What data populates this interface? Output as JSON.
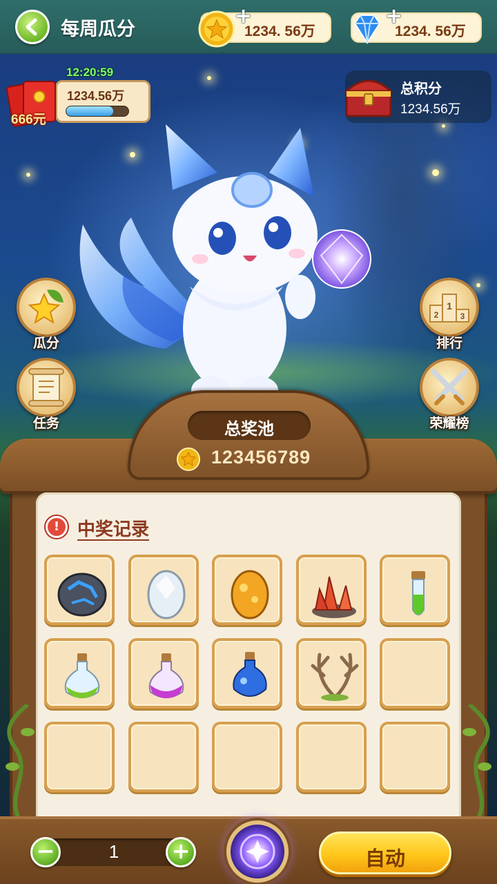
{
  "header": {
    "back_label": "",
    "title": "每周瓜分",
    "coins": "1234. 56万",
    "gems": "1234. 56万"
  },
  "red_envelope": {
    "countdown": "12:20:59",
    "amount_label": "666元",
    "value": "1234.56万",
    "progress": 0.75
  },
  "total_points": {
    "label": "总积分",
    "value": "1234.56万"
  },
  "side_buttons": {
    "left": [
      {
        "label": "瓜分",
        "icon": "star-leaf-icon"
      },
      {
        "label": "任务",
        "icon": "scroll-icon"
      }
    ],
    "right": [
      {
        "label": "排行",
        "icon": "podium-icon"
      },
      {
        "label": "荣耀榜",
        "icon": "crossed-swords-icon"
      }
    ]
  },
  "prize_pool": {
    "title": "总奖池",
    "value": "123456789"
  },
  "records_link": "中奖记录",
  "prize_items": [
    {
      "name": "dark-crystal-stone"
    },
    {
      "name": "silver-egg"
    },
    {
      "name": "golden-egg"
    },
    {
      "name": "red-crystal-cluster"
    },
    {
      "name": "green-potion-tube"
    },
    {
      "name": "green-potion-flask"
    },
    {
      "name": "purple-potion-flask"
    },
    {
      "name": "blue-potion-flask"
    },
    {
      "name": "antlers"
    },
    {
      "name": "empty"
    },
    {
      "name": "empty"
    },
    {
      "name": "empty"
    },
    {
      "name": "empty"
    },
    {
      "name": "empty"
    },
    {
      "name": "empty"
    }
  ],
  "controls": {
    "quantity": "1",
    "minus": "−",
    "plus": "+",
    "auto_label": "自动"
  },
  "colors": {
    "accent_green": "#6fb72a",
    "wood": "#7b5028",
    "gold_button": "#ffc61a",
    "paper": "#f6efe1"
  }
}
